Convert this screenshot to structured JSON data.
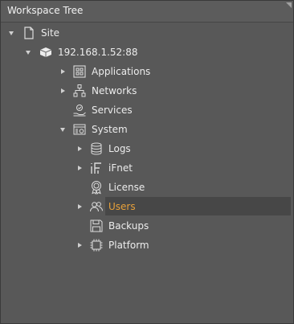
{
  "panel": {
    "title": "Workspace Tree"
  },
  "tree": {
    "site": {
      "label": "Site",
      "icon": "document-icon"
    },
    "host": {
      "label": "192.168.1.52:88",
      "icon": "server-icon"
    },
    "applications": {
      "label": "Applications",
      "icon": "applications-icon"
    },
    "networks": {
      "label": "Networks",
      "icon": "network-icon"
    },
    "services": {
      "label": "Services",
      "icon": "services-hand-icon"
    },
    "system": {
      "label": "System",
      "icon": "system-settings-icon"
    },
    "logs": {
      "label": "Logs",
      "icon": "database-icon"
    },
    "ifnet": {
      "label": "iFnet",
      "icon": "ifnet-icon"
    },
    "license": {
      "label": "License",
      "icon": "license-badge-icon"
    },
    "users": {
      "label": "Users",
      "icon": "users-icon"
    },
    "backups": {
      "label": "Backups",
      "icon": "floppy-disk-icon"
    },
    "platform": {
      "label": "Platform",
      "icon": "chip-icon"
    }
  },
  "colors": {
    "selected_text": "#e8a13a",
    "background": "#585858"
  }
}
